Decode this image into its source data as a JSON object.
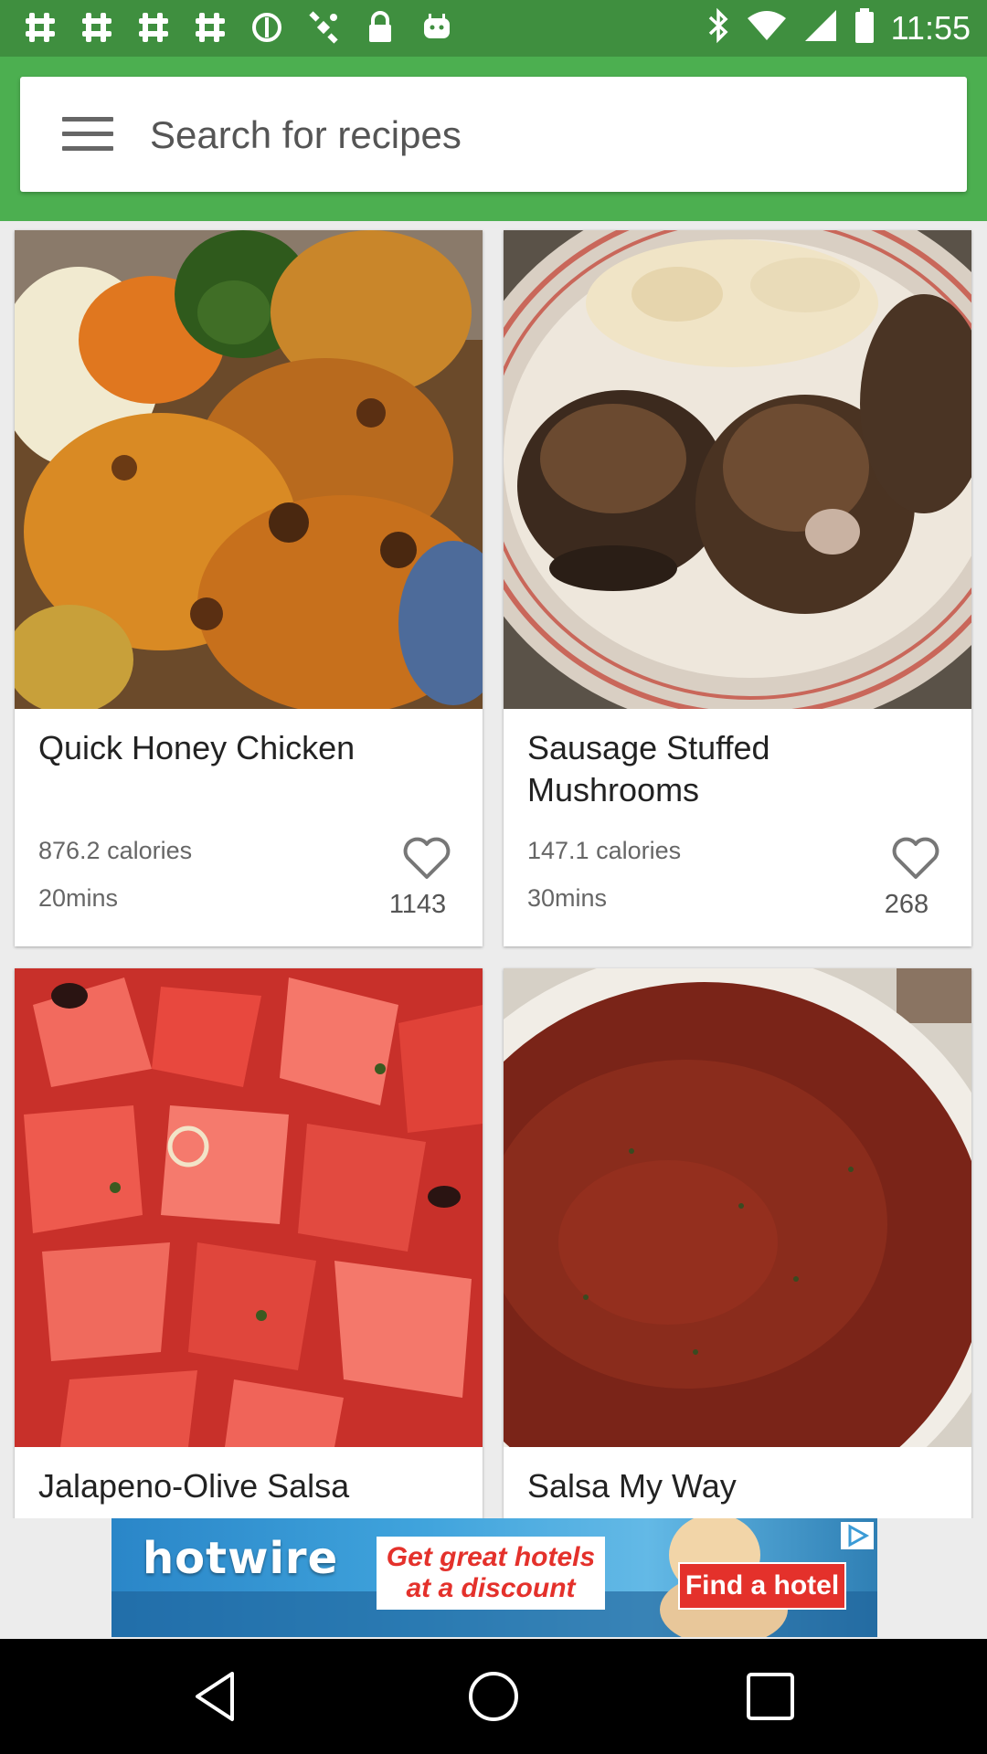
{
  "status_bar": {
    "time": "11:55",
    "left_icons": [
      "slack-icon",
      "slack-icon",
      "slack-icon",
      "slack-icon",
      "blocked-icon",
      "fake-gps-icon",
      "lock-icon",
      "android-icon"
    ],
    "right_icons": [
      "bluetooth-icon",
      "wifi-icon",
      "signal-icon",
      "battery-icon"
    ]
  },
  "search": {
    "placeholder": "Search for recipes",
    "menu_icon": "hamburger-menu-icon",
    "accent_color": "#4caf50"
  },
  "recipes": [
    {
      "title": "Quick Honey Chicken",
      "calories": "876.2 calories",
      "time": "20mins",
      "likes": "1143",
      "image": "honey-chicken-photo"
    },
    {
      "title": "Sausage Stuffed Mushrooms",
      "calories": "147.1 calories",
      "time": "30mins",
      "likes": "268",
      "image": "stuffed-mushrooms-photo"
    },
    {
      "title": "Jalapeno-Olive Salsa",
      "image": "tomato-salsa-photo"
    },
    {
      "title": "Salsa My Way",
      "image": "red-salsa-photo"
    }
  ],
  "ad": {
    "brand": "hotwire",
    "tagline": "Get great hotels at a discount",
    "cta": "Find a hotel"
  },
  "nav": {
    "icons": [
      "back-icon",
      "home-icon",
      "recents-icon"
    ]
  }
}
